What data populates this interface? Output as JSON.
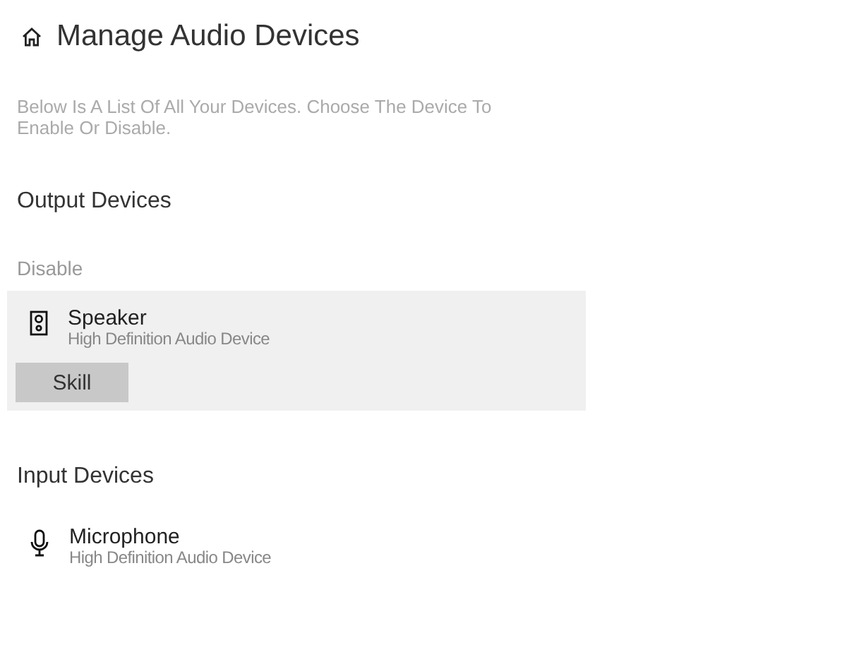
{
  "header": {
    "title": "Manage Audio Devices"
  },
  "description": "Below Is A List Of All Your Devices. Choose The Device To Enable Or Disable.",
  "sections": [
    {
      "title": "Output Devices",
      "status": "Disable",
      "devices": [
        {
          "kind": "speaker",
          "name": "Speaker",
          "subtitle": "High Definition Audio Device",
          "selected": true,
          "button": "Skill"
        }
      ]
    },
    {
      "title": "Input Devices",
      "devices": [
        {
          "kind": "microphone",
          "name": "Microphone",
          "subtitle": "High Definition Audio Device",
          "selected": false
        }
      ]
    }
  ]
}
